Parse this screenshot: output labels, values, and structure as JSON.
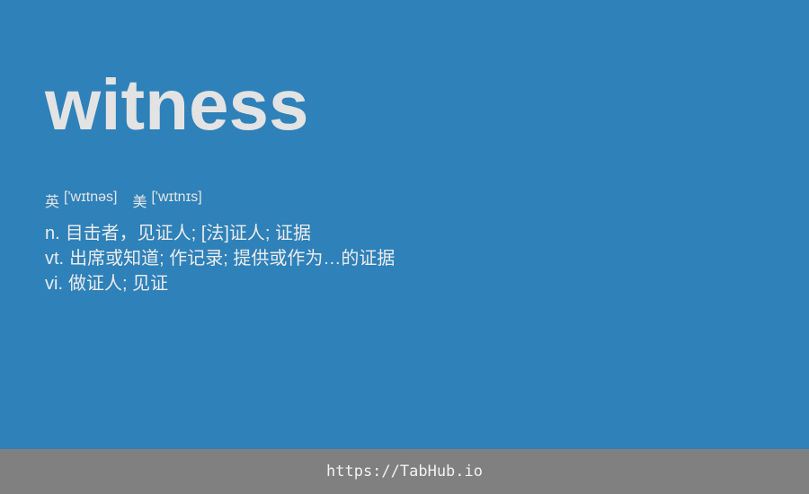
{
  "entry": {
    "word": "witness",
    "phonetics": {
      "uk_label": "英",
      "uk": "['wɪtnəs]",
      "us_label": "美",
      "us": "['wɪtnɪs]"
    },
    "definitions": [
      {
        "pos": "n.",
        "text": "目击者，见证人; [法]证人; 证据"
      },
      {
        "pos": "vt.",
        "text": "出席或知道; 作记录; 提供或作为…的证据"
      },
      {
        "pos": "vi.",
        "text": "做证人; 见证"
      }
    ]
  },
  "footer": {
    "link_text": "https://TabHub.io"
  },
  "colors": {
    "background": "#2e81b9",
    "word": "#e3e3e3",
    "footer_bar": "#808080"
  }
}
